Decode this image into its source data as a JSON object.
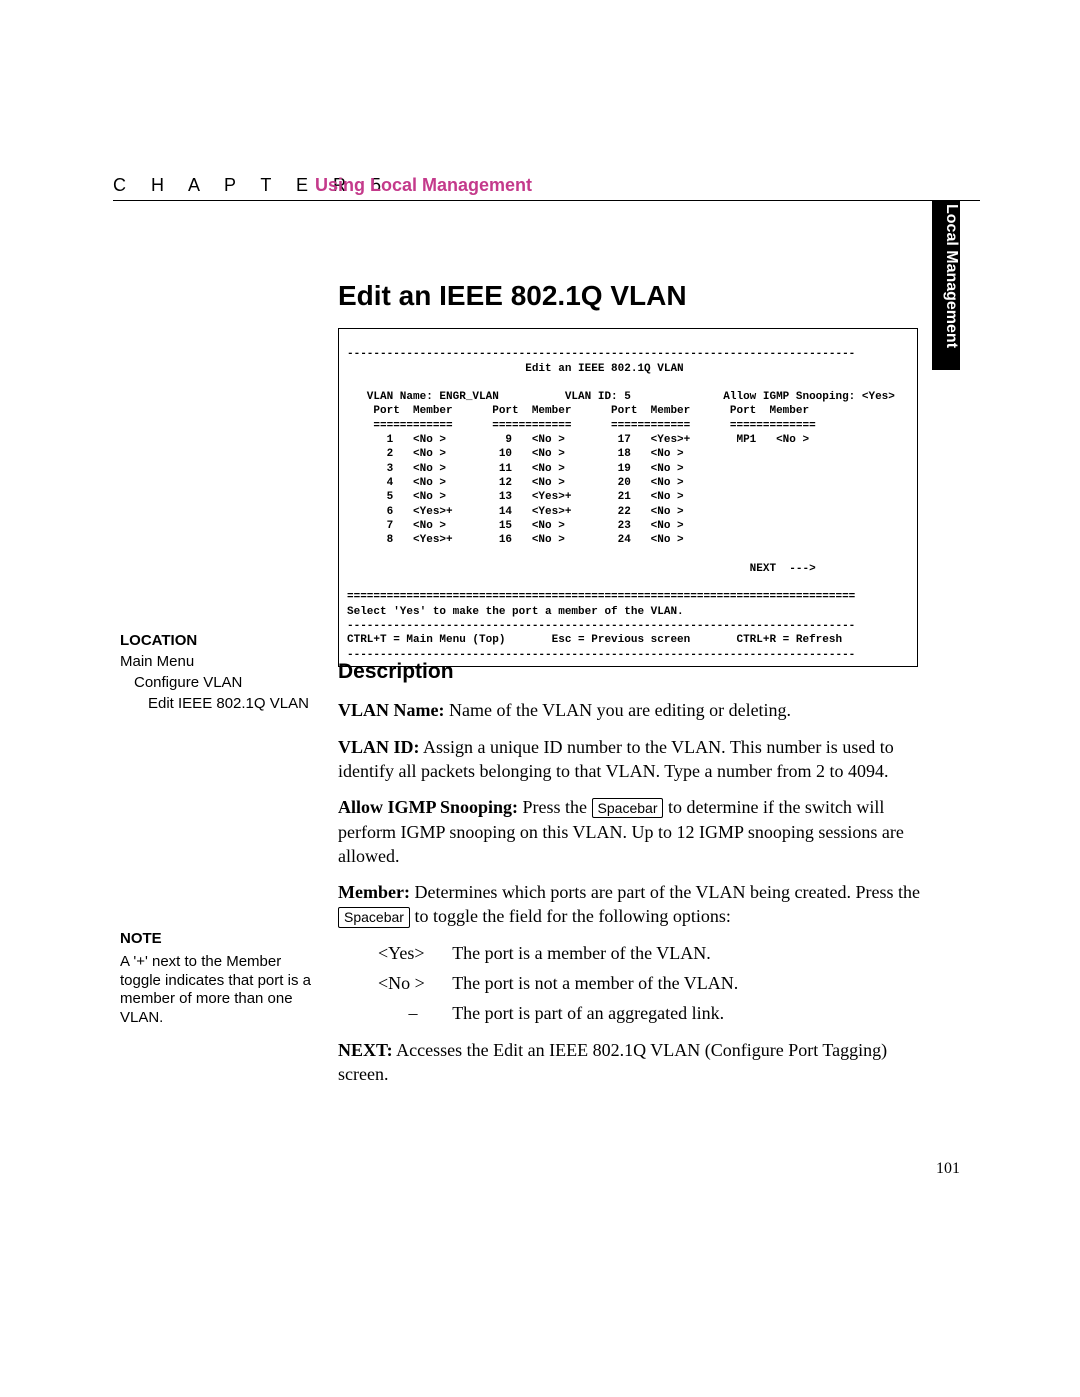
{
  "header": {
    "chapter_prefix": "C H A P T E R  5",
    "chapter_title": "Using Local Management",
    "side_tab": "Local Management"
  },
  "main_title": "Edit an IEEE 802.1Q VLAN",
  "terminal": {
    "sep_long": "-----------------------------------------------------------------------------",
    "sep_eq": "=============================================================================",
    "title_line": "                           Edit an IEEE 802.1Q VLAN",
    "header1": "   VLAN Name: ENGR_VLAN          VLAN ID: 5              Allow IGMP Snooping: <Yes>",
    "header2": "    Port  Member      Port  Member      Port  Member      Port  Member",
    "header3": "    ============      ============      ============      =============",
    "r1": "      1   <No >         9   <No >        17   <Yes>+       MP1   <No >",
    "r2": "      2   <No >        10   <No >        18   <No >",
    "r3": "      3   <No >        11   <No >        19   <No >",
    "r4": "      4   <No >        12   <No >        20   <No >",
    "r5": "      5   <No >        13   <Yes>+       21   <No >",
    "r6": "      6   <Yes>+       14   <Yes>+       22   <No >",
    "r7": "      7   <No >        15   <No >        23   <No >",
    "r8": "      8   <Yes>+       16   <No >        24   <No >",
    "next_line": "                                                             NEXT  --->",
    "help_line": "Select 'Yes' to make the port a member of the VLAN.",
    "footer_line": "CTRL+T = Main Menu (Top)       Esc = Previous screen       CTRL+R = Refresh"
  },
  "location": {
    "heading": "LOCATION",
    "l1": "Main Menu",
    "l2": "Configure VLAN",
    "l3": "Edit IEEE 802.1Q VLAN"
  },
  "note": {
    "heading": "NOTE",
    "text": "A '+' next to the Member toggle indicates that port is a member of more than one VLAN."
  },
  "description": {
    "heading": "Description",
    "vlan_name_label": "VLAN Name:",
    "vlan_name_text": " Name of the VLAN you are editing or deleting.",
    "vlan_id_label": "VLAN ID:",
    "vlan_id_text": " Assign a unique ID number to the VLAN. This number is used to identify all packets belonging to that VLAN. Type a number from 2 to 4094.",
    "igmp_label": "Allow IGMP Snooping:",
    "igmp_pre": " Press the ",
    "spacebar": "Spacebar",
    "igmp_post": " to determine if the switch will perform IGMP snooping on this VLAN. Up to 12 IGMP snooping sessions are allowed.",
    "member_label": "Member:",
    "member_pre": " Determines which ports are part of the VLAN being created. Press the ",
    "member_post": " to toggle the field for the following options:",
    "opt_yes_k": "<Yes>",
    "opt_yes_v": "The port is a member of the VLAN.",
    "opt_no_k": "<No >",
    "opt_no_v": "The port is not a member of the VLAN.",
    "opt_dash_k": "–",
    "opt_dash_v": "The port is part of an aggregated link.",
    "next_label": "NEXT:",
    "next_text": " Accesses the Edit an IEEE 802.1Q VLAN (Configure Port Tagging) screen."
  },
  "page_number": "101"
}
